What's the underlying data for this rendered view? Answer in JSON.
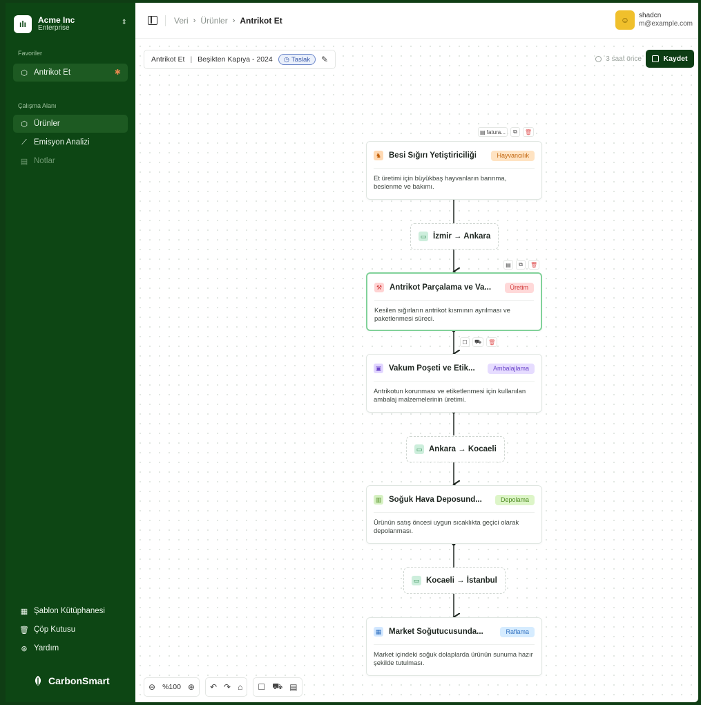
{
  "org": {
    "name": "Acme Inc",
    "plan": "Enterprise",
    "logo": "ılı"
  },
  "sidebar": {
    "favorites_label": "Favoriler",
    "favorites": [
      {
        "label": "Antrikot Et"
      }
    ],
    "workspace_label": "Çalışma Alanı",
    "workspace": [
      {
        "label": "Ürünler"
      },
      {
        "label": "Emisyon Analizi"
      },
      {
        "label": "Notlar"
      }
    ],
    "footer": [
      {
        "label": "Şablon Kütüphanesi"
      },
      {
        "label": "Çöp Kutusu"
      },
      {
        "label": "Yardım"
      }
    ],
    "brand": "CarbonSmart"
  },
  "header": {
    "breadcrumb": [
      "Veri",
      "Ürünler",
      "Antrikot Et"
    ],
    "user_name": "shadcn",
    "user_email": "m@example.com"
  },
  "document": {
    "name": "Antrikot Et",
    "scope": "Beşikten Kapıya - 2024",
    "status": "Taslak",
    "saved_time": "3 saat önce",
    "save_label": "Kaydet"
  },
  "flow": {
    "nodes": [
      {
        "title": "Besi Sığırı Yetiştiriciliği",
        "tag": "Hayvancılık",
        "desc": "Et üretimi için büyükbaş hayvanların barınma, beslenme ve bakımı."
      },
      {
        "title": "Antrikot Parçalama ve Va...",
        "tag": "Üretim",
        "desc": "Kesilen sığırların antrikot kısmının ayrılması ve paketlenmesi süreci."
      },
      {
        "title": "Vakum Poşeti ve Etik...",
        "tag": "Ambalajlama",
        "desc": "Antrikotun korunması ve etiketlenmesi için kullanılan ambalaj malzemelerinin üretimi."
      },
      {
        "title": "Soğuk Hava Deposund...",
        "tag": "Depolama",
        "desc": "Ürünün satış öncesi uygun sıcaklıkta geçici olarak depolanması."
      },
      {
        "title": "Market Soğutucusunda...",
        "tag": "Raflama",
        "desc": "Market içindeki soğuk dolaplarda ürünün sunuma hazır şekilde tutulması."
      }
    ],
    "transports": [
      {
        "label": "İzmir → Ankara"
      },
      {
        "label": "Ankara → Kocaeli"
      },
      {
        "label": "Kocaeli → İstanbul"
      }
    ],
    "attachment_label": "fatura..."
  },
  "toolbar": {
    "zoom": "%100"
  },
  "colors": {
    "sidebar_bg": "#0d4614",
    "accent": "#0d3d14",
    "tag_hayvancilik": "#ffe3c2",
    "tag_uretim": "#ffd9d9",
    "tag_ambalajlama": "#e6dcff",
    "tag_depolama": "#ddf5c8",
    "tag_raflama": "#d6ecff"
  }
}
